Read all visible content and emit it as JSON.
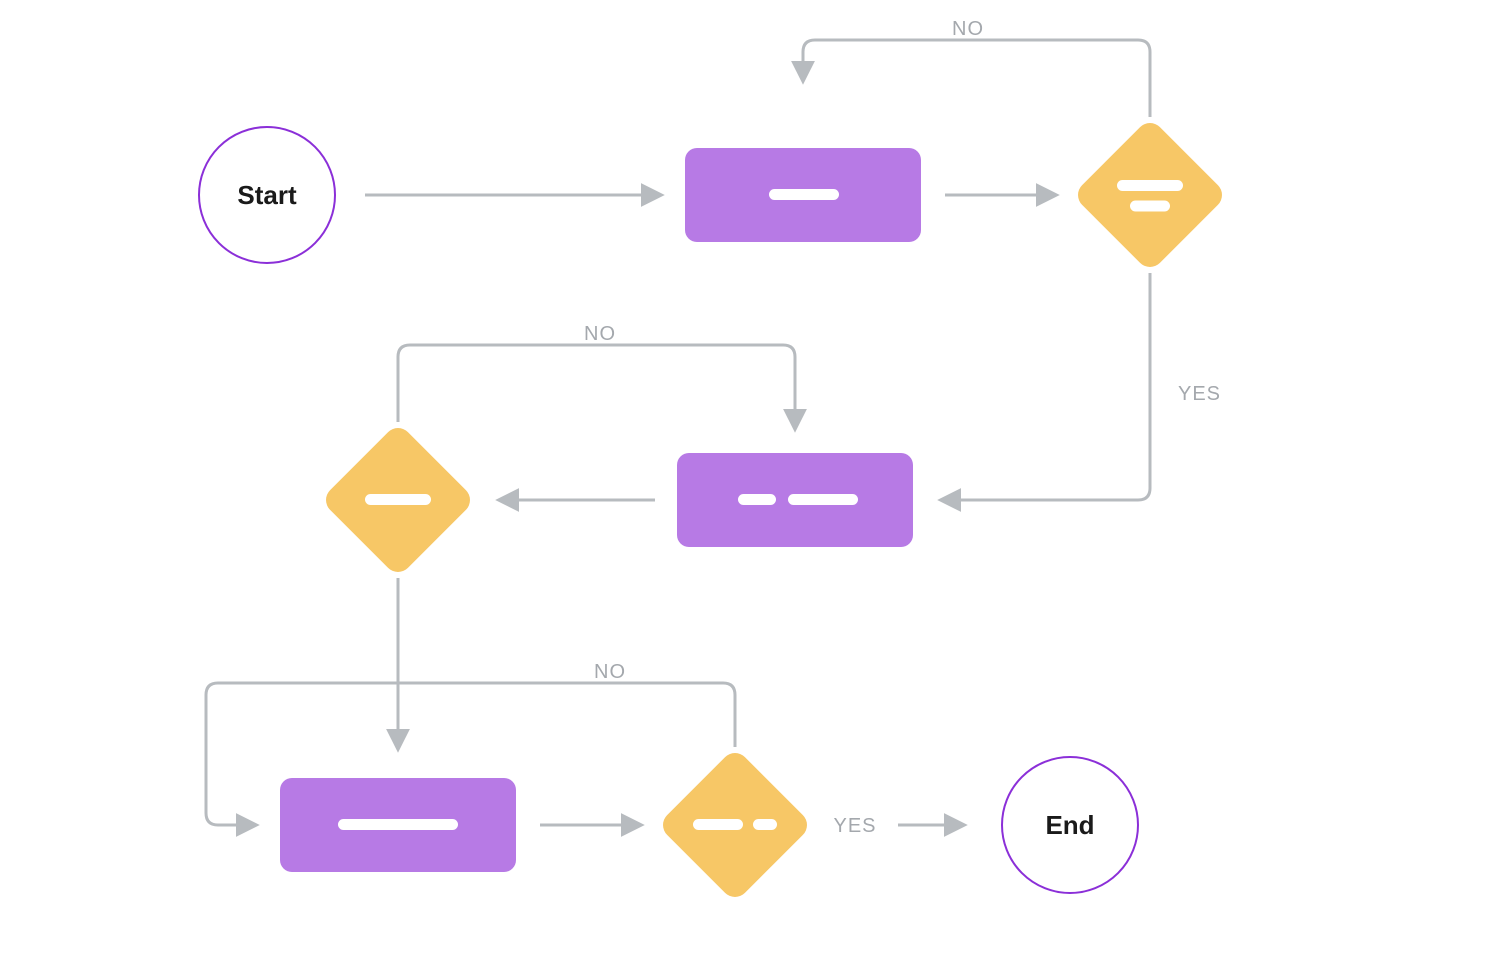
{
  "colors": {
    "terminator_stroke": "#8B2FD8",
    "process_fill": "#B77AE5",
    "decision_fill": "#F7C766",
    "connector": "#B7BBBF",
    "label": "#A4A8AD",
    "placeholder": "#FFFFFF"
  },
  "nodes": {
    "start": {
      "type": "terminator",
      "label": "Start"
    },
    "p1": {
      "type": "process"
    },
    "d1": {
      "type": "decision"
    },
    "p2": {
      "type": "process"
    },
    "d2": {
      "type": "decision"
    },
    "p3": {
      "type": "process"
    },
    "d3": {
      "type": "decision"
    },
    "end": {
      "type": "terminator",
      "label": "End"
    }
  },
  "edges": {
    "start_p1": {
      "label": ""
    },
    "p1_d1": {
      "label": ""
    },
    "d1_p1_no": {
      "label": "NO"
    },
    "d1_p2_yes": {
      "label": "YES"
    },
    "p2_d2": {
      "label": ""
    },
    "d2_p2_no": {
      "label": "NO"
    },
    "d2_p3": {
      "label": ""
    },
    "p3_d3": {
      "label": ""
    },
    "d3_p3_no": {
      "label": "NO"
    },
    "d3_end_yes": {
      "label": "YES"
    }
  }
}
